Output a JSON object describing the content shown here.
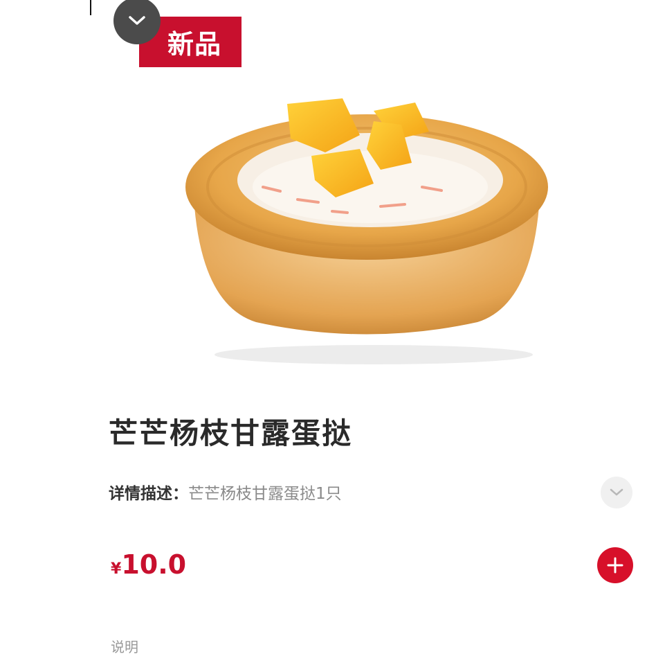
{
  "badge": {
    "label": "新品"
  },
  "product": {
    "name": "芒芒杨枝甘露蛋挞",
    "description_label": "详情描述：",
    "description": "芒芒杨枝甘露蛋挞1只",
    "currency": "¥",
    "price": "10.0"
  },
  "footer": {
    "note_label": "说明"
  },
  "colors": {
    "accent": "#c8102e",
    "collapse_button": "#4b4b4b",
    "muted_text": "#8a8a8a"
  },
  "icons": {
    "collapse": "chevron-down-icon",
    "expand": "chevron-down-icon",
    "add": "plus-icon"
  }
}
